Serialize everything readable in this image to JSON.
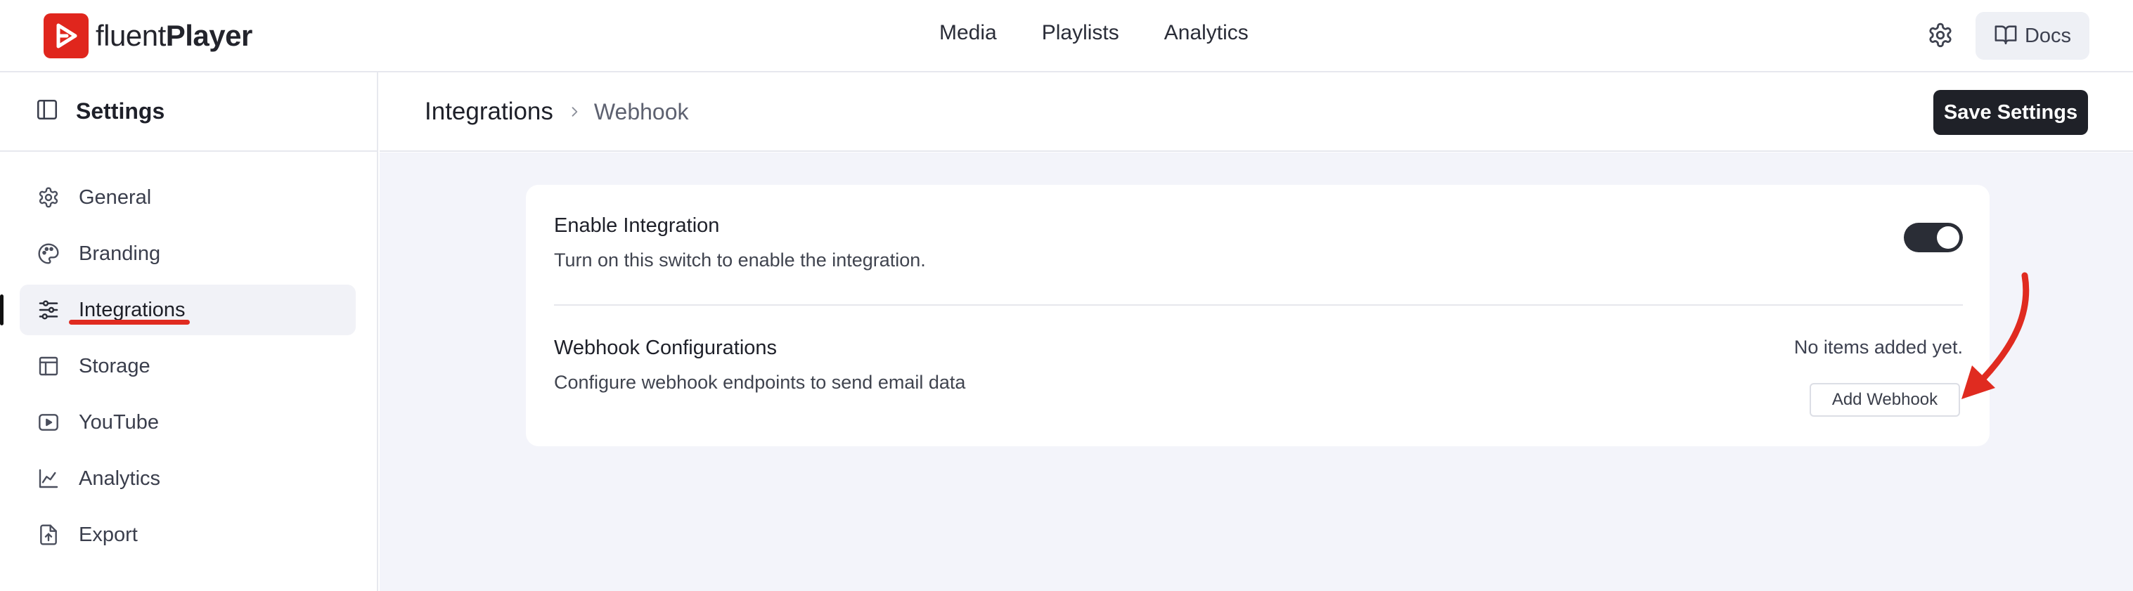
{
  "brand": {
    "name_light": "fluent",
    "name_bold": "Player",
    "color": "#e0261d"
  },
  "topnav": {
    "items": [
      {
        "label": "Media"
      },
      {
        "label": "Playlists"
      },
      {
        "label": "Analytics"
      }
    ],
    "settings_icon": "gear-icon",
    "docs_label": "Docs",
    "docs_icon": "book-open-icon"
  },
  "sidebar": {
    "title": "Settings",
    "toggle_icon": "sidebar-panel-icon",
    "items": [
      {
        "label": "General",
        "icon": "gear-icon"
      },
      {
        "label": "Branding",
        "icon": "palette-icon"
      },
      {
        "label": "Integrations",
        "icon": "sliders-icon",
        "active": true
      },
      {
        "label": "Storage",
        "icon": "storage-layout-icon"
      },
      {
        "label": "YouTube",
        "icon": "play-square-icon"
      },
      {
        "label": "Analytics",
        "icon": "line-chart-icon"
      },
      {
        "label": "Export",
        "icon": "file-export-icon"
      }
    ]
  },
  "header": {
    "breadcrumb_root": "Integrations",
    "breadcrumb_current": "Webhook",
    "save_label": "Save Settings"
  },
  "card": {
    "enable_title": "Enable Integration",
    "enable_desc": "Turn on this switch to enable the integration.",
    "enabled": true,
    "webhook_title": "Webhook Configurations",
    "webhook_desc": "Configure webhook endpoints to send email data",
    "empty_note": "No items added yet.",
    "add_label": "Add Webhook"
  },
  "annotation_color": "#e02b20"
}
